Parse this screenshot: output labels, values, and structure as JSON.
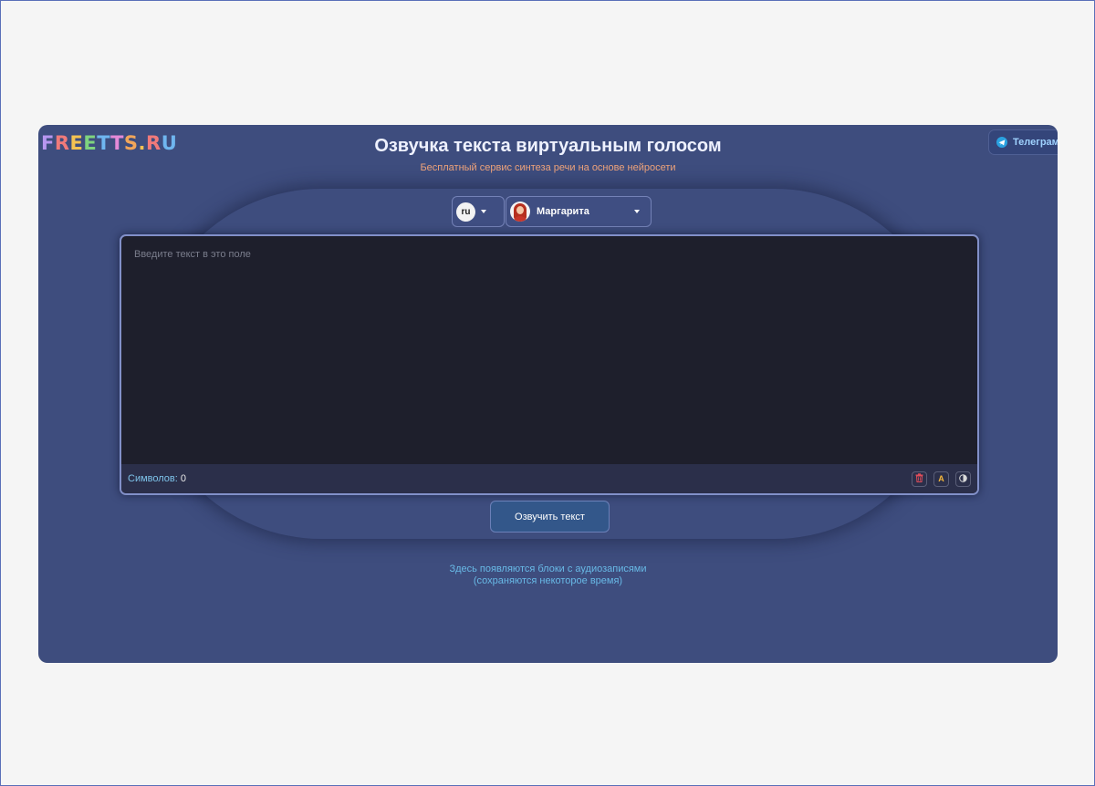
{
  "header": {
    "logo_letters": [
      "F",
      "R",
      "E",
      "E",
      "T",
      "T",
      "S",
      ".",
      "R",
      "U"
    ],
    "logo_colors": [
      "#b896f0",
      "#f07a7a",
      "#f4c252",
      "#7fd47f",
      "#6fb6f0",
      "#e48ad8",
      "#f2a65a",
      "#f4c252",
      "#f07a7a",
      "#6fb6f0"
    ],
    "title": "Озвучка текста виртуальным голосом",
    "subtitle": "Бесплатный сервис синтеза речи на основе нейросети",
    "telegram_label": "Телеграм"
  },
  "controls": {
    "language": "ru",
    "voice": "Маргарита"
  },
  "editor": {
    "placeholder": "Введите текст в это поле",
    "value": "",
    "char_label": "Символов:",
    "char_count": "0",
    "tools": [
      {
        "name": "trash-icon",
        "glyph": "🗑",
        "color": "#e04d5a"
      },
      {
        "name": "font-a-icon",
        "glyph": "A",
        "color": "#f4b73a"
      },
      {
        "name": "contrast-icon",
        "glyph": "◑",
        "color": "#d8d8d8"
      }
    ]
  },
  "actions": {
    "speak_label": "Озвучить текст"
  },
  "audio_hint": {
    "line1": "Здесь появляются блоки с аудиозаписями",
    "line2": "(сохраняются некоторое время)"
  },
  "colors": {
    "app_bg": "#3e4d7e",
    "subtitle": "#f0a47b",
    "hint": "#68b9e6"
  }
}
